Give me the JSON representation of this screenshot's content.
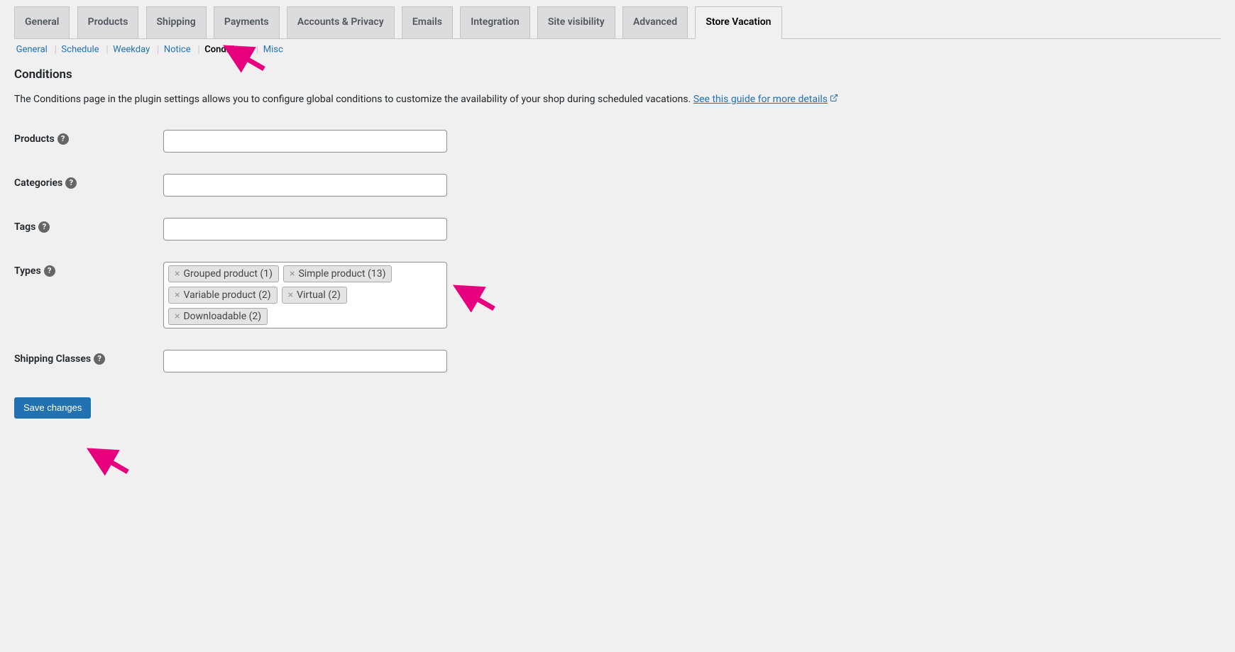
{
  "tabs": [
    {
      "label": "General"
    },
    {
      "label": "Products"
    },
    {
      "label": "Shipping"
    },
    {
      "label": "Payments"
    },
    {
      "label": "Accounts & Privacy"
    },
    {
      "label": "Emails"
    },
    {
      "label": "Integration"
    },
    {
      "label": "Site visibility"
    },
    {
      "label": "Advanced"
    },
    {
      "label": "Store Vacation",
      "active": true
    }
  ],
  "subtabs": {
    "general": "General",
    "schedule": "Schedule",
    "weekday": "Weekday",
    "notice": "Notice",
    "conditions": "Conditions",
    "misc": "Misc"
  },
  "heading": "Conditions",
  "description": "The Conditions page in the plugin settings allows you to configure global conditions to customize the availability of your shop during scheduled vacations.",
  "guide_link": "See this guide for more details",
  "fields": {
    "products": "Products",
    "categories": "Categories",
    "tags": "Tags",
    "types": "Types",
    "shipping_classes": "Shipping Classes"
  },
  "types_selected": [
    "Grouped product (1)",
    "Simple product (13)",
    "Variable product (2)",
    "Virtual (2)",
    "Downloadable (2)"
  ],
  "save_button": "Save changes"
}
